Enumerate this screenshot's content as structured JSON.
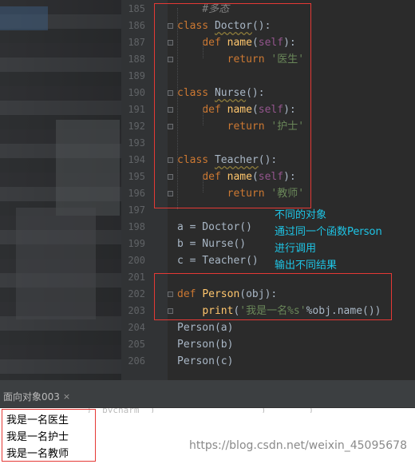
{
  "editor": {
    "lines": [
      {
        "n": "185",
        "parts": [
          {
            "t": "    #多态",
            "c": "cm"
          }
        ]
      },
      {
        "n": "186",
        "parts": [
          {
            "t": "class",
            "c": "kw"
          },
          {
            "t": " "
          },
          {
            "t": "Doctor",
            "c": "wv"
          },
          {
            "t": "():"
          }
        ]
      },
      {
        "n": "187",
        "parts": [
          {
            "t": "    "
          },
          {
            "t": "def",
            "c": "kw"
          },
          {
            "t": " "
          },
          {
            "t": "name",
            "c": "fn"
          },
          {
            "t": "("
          },
          {
            "t": "self",
            "c": "self"
          },
          {
            "t": "):"
          }
        ]
      },
      {
        "n": "188",
        "parts": [
          {
            "t": "        "
          },
          {
            "t": "return",
            "c": "kw"
          },
          {
            "t": " "
          },
          {
            "t": "'医生'",
            "c": "str"
          }
        ]
      },
      {
        "n": "189",
        "parts": []
      },
      {
        "n": "190",
        "parts": [
          {
            "t": "class",
            "c": "kw"
          },
          {
            "t": " "
          },
          {
            "t": "Nurse",
            "c": "wv"
          },
          {
            "t": "():"
          }
        ]
      },
      {
        "n": "191",
        "parts": [
          {
            "t": "    "
          },
          {
            "t": "def",
            "c": "kw"
          },
          {
            "t": " "
          },
          {
            "t": "name",
            "c": "fn"
          },
          {
            "t": "("
          },
          {
            "t": "self",
            "c": "self"
          },
          {
            "t": "):"
          }
        ]
      },
      {
        "n": "192",
        "parts": [
          {
            "t": "        "
          },
          {
            "t": "return",
            "c": "kw"
          },
          {
            "t": " "
          },
          {
            "t": "'护士'",
            "c": "str"
          }
        ]
      },
      {
        "n": "193",
        "parts": []
      },
      {
        "n": "194",
        "parts": [
          {
            "t": "class",
            "c": "kw"
          },
          {
            "t": " "
          },
          {
            "t": "Teacher",
            "c": "wv"
          },
          {
            "t": "():"
          }
        ]
      },
      {
        "n": "195",
        "parts": [
          {
            "t": "    "
          },
          {
            "t": "def",
            "c": "kw"
          },
          {
            "t": " "
          },
          {
            "t": "name",
            "c": "fn"
          },
          {
            "t": "("
          },
          {
            "t": "self",
            "c": "self"
          },
          {
            "t": "):"
          }
        ]
      },
      {
        "n": "196",
        "parts": [
          {
            "t": "        "
          },
          {
            "t": "return",
            "c": "kw"
          },
          {
            "t": " "
          },
          {
            "t": "'教师'",
            "c": "str"
          }
        ]
      },
      {
        "n": "197",
        "parts": []
      },
      {
        "n": "198",
        "parts": [
          {
            "t": "a = Doctor()"
          }
        ]
      },
      {
        "n": "199",
        "parts": [
          {
            "t": "b = Nurse()"
          }
        ]
      },
      {
        "n": "200",
        "parts": [
          {
            "t": "c = Teacher()"
          }
        ]
      },
      {
        "n": "201",
        "parts": []
      },
      {
        "n": "202",
        "parts": [
          {
            "t": "def",
            "c": "kw"
          },
          {
            "t": " "
          },
          {
            "t": "Person",
            "c": "fn"
          },
          {
            "t": "(obj):"
          }
        ]
      },
      {
        "n": "203",
        "parts": [
          {
            "t": "    "
          },
          {
            "t": "print",
            "c": "fn2"
          },
          {
            "t": "("
          },
          {
            "t": "'我是一名%s'",
            "c": "str"
          },
          {
            "t": "%obj.name())"
          }
        ]
      },
      {
        "n": "204",
        "parts": [
          {
            "t": "Person(a)"
          }
        ]
      },
      {
        "n": "205",
        "parts": [
          {
            "t": "Person(b)"
          }
        ]
      },
      {
        "n": "206",
        "parts": [
          {
            "t": "Person(c)"
          }
        ]
      }
    ]
  },
  "annotations": [
    "不同的对象",
    "通过同一个函数Person",
    "进行调用",
    "输出不同结果"
  ],
  "console": {
    "tab_label": "面向对象003",
    "tab_close": "×",
    "cut_command": "  )  pycharm  )                    )        )",
    "output": [
      "我是一名医生",
      "我是一名护士",
      "我是一名教师"
    ]
  },
  "watermark": "https://blog.csdn.net/weixin_45095678",
  "colors": {
    "annotation": "#1ec5e6",
    "highlight_box": "#e53935",
    "keyword": "#cc7832",
    "string": "#6a8759",
    "function": "#ffc66d"
  }
}
